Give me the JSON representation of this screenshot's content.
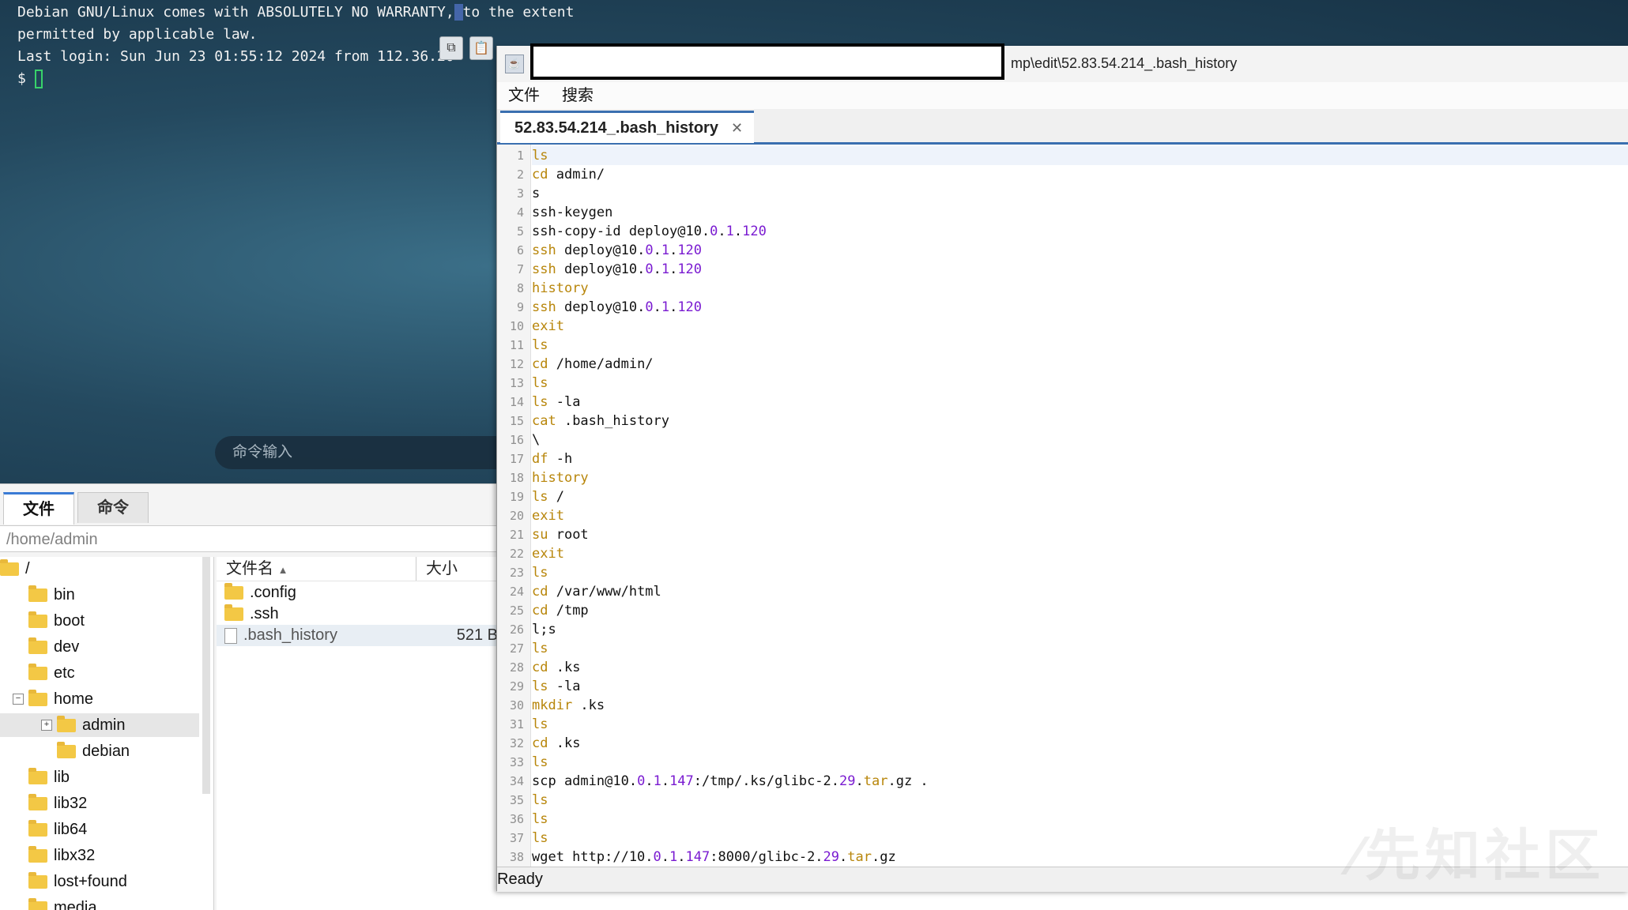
{
  "terminal": {
    "lines": [
      "Debian GNU/Linux comes with ABSOLUTELY NO WARRANTY, to the extent",
      "permitted by applicable law.",
      "Last login: Sun Jun 23 01:55:12 2024 from 112.36.20"
    ],
    "prompt": "$",
    "command_input_placeholder": "命令输入",
    "cursor_color": "#38d26a"
  },
  "bottom_panel": {
    "tabs": [
      "文件",
      "命令"
    ],
    "active_tab": "文件",
    "path": "/home/admin",
    "tree": [
      {
        "label": "/"
      },
      {
        "label": "bin"
      },
      {
        "label": "boot"
      },
      {
        "label": "dev"
      },
      {
        "label": "etc"
      },
      {
        "label": "home"
      },
      {
        "label": "admin"
      },
      {
        "label": "debian"
      },
      {
        "label": "lib"
      },
      {
        "label": "lib32"
      },
      {
        "label": "lib64"
      },
      {
        "label": "libx32"
      },
      {
        "label": "lost+found"
      },
      {
        "label": "media"
      }
    ],
    "file_columns": {
      "name": "文件名",
      "size": "大小"
    },
    "files": [
      {
        "name": ".config",
        "size": ""
      },
      {
        "name": ".ssh",
        "size": ""
      },
      {
        "name": ".bash_history",
        "size": "521 B"
      }
    ]
  },
  "editor": {
    "title_path": "mp\\edit\\52.83.54.214_.bash_history",
    "menu": [
      "文件",
      "搜索"
    ],
    "tab_label": "52.83.54.214_.bash_history",
    "status": "Ready",
    "lines": [
      [
        [
          "kw",
          "ls"
        ]
      ],
      [
        [
          "kw",
          "cd"
        ],
        [
          "t",
          " admin/"
        ]
      ],
      [
        [
          "t",
          "s"
        ]
      ],
      [
        [
          "t",
          "ssh-keygen"
        ]
      ],
      [
        [
          "t",
          "ssh-copy-id deploy@10."
        ],
        [
          "num",
          "0"
        ],
        [
          "t",
          "."
        ],
        [
          "num",
          "1"
        ],
        [
          "t",
          "."
        ],
        [
          "num",
          "120"
        ]
      ],
      [
        [
          "kw",
          "ssh"
        ],
        [
          "t",
          " deploy@10."
        ],
        [
          "num",
          "0"
        ],
        [
          "t",
          "."
        ],
        [
          "num",
          "1"
        ],
        [
          "t",
          "."
        ],
        [
          "num",
          "120"
        ]
      ],
      [
        [
          "kw",
          "ssh"
        ],
        [
          "t",
          " deploy@10."
        ],
        [
          "num",
          "0"
        ],
        [
          "t",
          "."
        ],
        [
          "num",
          "1"
        ],
        [
          "t",
          "."
        ],
        [
          "num",
          "120"
        ]
      ],
      [
        [
          "kw",
          "history"
        ]
      ],
      [
        [
          "kw",
          "ssh"
        ],
        [
          "t",
          " deploy@10."
        ],
        [
          "num",
          "0"
        ],
        [
          "t",
          "."
        ],
        [
          "num",
          "1"
        ],
        [
          "t",
          "."
        ],
        [
          "num",
          "120"
        ]
      ],
      [
        [
          "kw",
          "exit"
        ]
      ],
      [
        [
          "kw",
          "ls"
        ]
      ],
      [
        [
          "kw",
          "cd"
        ],
        [
          "t",
          " /home/admin/"
        ]
      ],
      [
        [
          "kw",
          "ls"
        ]
      ],
      [
        [
          "kw",
          "ls"
        ],
        [
          "t",
          " -la"
        ]
      ],
      [
        [
          "kw",
          "cat"
        ],
        [
          "t",
          " .bash_history"
        ]
      ],
      [
        [
          "t",
          "\\"
        ]
      ],
      [
        [
          "kw",
          "df"
        ],
        [
          "t",
          " -h"
        ]
      ],
      [
        [
          "kw",
          "history"
        ]
      ],
      [
        [
          "kw",
          "ls"
        ],
        [
          "t",
          " /"
        ]
      ],
      [
        [
          "kw",
          "exit"
        ]
      ],
      [
        [
          "kw",
          "su"
        ],
        [
          "t",
          " root"
        ]
      ],
      [
        [
          "kw",
          "exit"
        ]
      ],
      [
        [
          "kw",
          "ls"
        ]
      ],
      [
        [
          "kw",
          "cd"
        ],
        [
          "t",
          " /var/www/html"
        ]
      ],
      [
        [
          "kw",
          "cd"
        ],
        [
          "t",
          " /tmp"
        ]
      ],
      [
        [
          "t",
          "l;s"
        ]
      ],
      [
        [
          "kw",
          "ls"
        ]
      ],
      [
        [
          "kw",
          "cd"
        ],
        [
          "t",
          " .ks"
        ]
      ],
      [
        [
          "kw",
          "ls"
        ],
        [
          "t",
          " -la"
        ]
      ],
      [
        [
          "kw",
          "mkdir"
        ],
        [
          "t",
          " .ks"
        ]
      ],
      [
        [
          "kw",
          "ls"
        ]
      ],
      [
        [
          "kw",
          "cd"
        ],
        [
          "t",
          " .ks"
        ]
      ],
      [
        [
          "kw",
          "ls"
        ]
      ],
      [
        [
          "t",
          "scp admin@10."
        ],
        [
          "num",
          "0"
        ],
        [
          "t",
          "."
        ],
        [
          "num",
          "1"
        ],
        [
          "t",
          "."
        ],
        [
          "num",
          "147"
        ],
        [
          "t",
          ":/tmp/.ks/glibc-2."
        ],
        [
          "num",
          "29"
        ],
        [
          "t",
          "."
        ],
        [
          "kw",
          "tar"
        ],
        [
          "t",
          ".gz ."
        ]
      ],
      [
        [
          "kw",
          "ls"
        ]
      ],
      [
        [
          "kw",
          "ls"
        ]
      ],
      [
        [
          "kw",
          "ls"
        ]
      ],
      [
        [
          "t",
          "wget http://10."
        ],
        [
          "num",
          "0"
        ],
        [
          "t",
          "."
        ],
        [
          "num",
          "1"
        ],
        [
          "t",
          "."
        ],
        [
          "num",
          "147"
        ],
        [
          "t",
          ":8000/glibc-2."
        ],
        [
          "num",
          "29"
        ],
        [
          "t",
          "."
        ],
        [
          "kw",
          "tar"
        ],
        [
          "t",
          ".gz"
        ]
      ]
    ]
  },
  "colors": {
    "keyword": "#b8860b",
    "number": "#7a1bd1",
    "accent": "#3a6fb0"
  }
}
